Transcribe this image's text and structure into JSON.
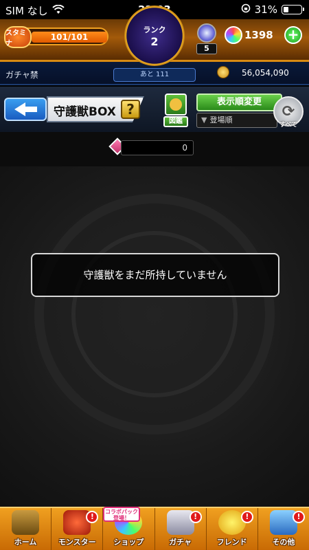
{
  "status_bar": {
    "carrier": "SIM なし",
    "time": "22:03",
    "battery": "31%",
    "battery_level": 0.31
  },
  "header": {
    "stamina_label": "スタミナ",
    "stamina_value": "101/101",
    "stamina_level": 1.0,
    "rank_label": "ランク",
    "rank_value": "2",
    "rank_next": "あと 111",
    "orb_count": "5",
    "gem_count": "1398",
    "gacha_ban": "ガチャ禁",
    "gold_count": "56,054,090"
  },
  "titlebar": {
    "title": "守護獣BOX",
    "help": "?",
    "zukan_label": "図鑑",
    "sort_button": "表示順変更",
    "sort_order": "登場順",
    "filter_label": "すべて"
  },
  "count_bar": {
    "count": "0"
  },
  "main": {
    "empty_message": "守護獣をまだ所持していません"
  },
  "bottom_nav": {
    "items": [
      {
        "label": "ホーム",
        "badge": ""
      },
      {
        "label": "モンスター",
        "badge": "!"
      },
      {
        "label": "ショップ",
        "badge": ""
      },
      {
        "label": "ガチャ",
        "badge": "!"
      },
      {
        "label": "フレンド",
        "badge": "!"
      },
      {
        "label": "その他",
        "badge": "!"
      }
    ],
    "collab_tag": "コラボパック 登場！"
  },
  "colors": {
    "accent_orange": "#f0a020",
    "header_blue": "#0a1a3a",
    "green_button": "#2a8a1a"
  }
}
